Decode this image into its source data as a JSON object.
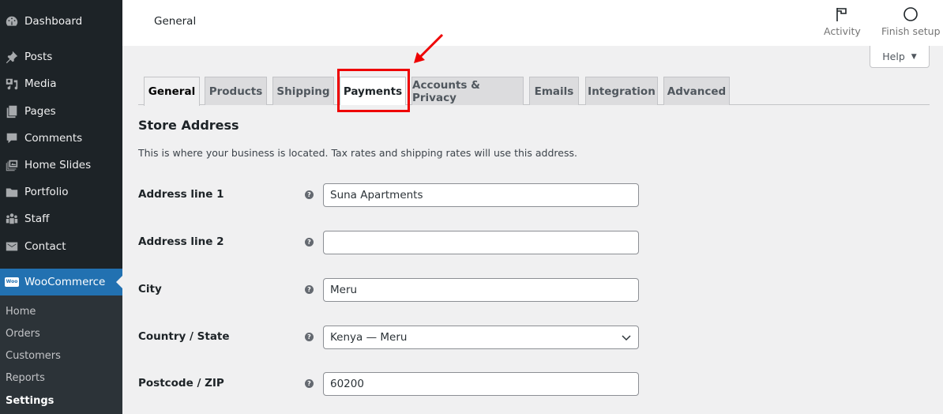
{
  "sidebar": {
    "items": [
      {
        "label": "Dashboard",
        "icon": "dashboard-icon"
      },
      {
        "label": "Posts",
        "icon": "pin-icon"
      },
      {
        "label": "Media",
        "icon": "media-icon"
      },
      {
        "label": "Pages",
        "icon": "pages-icon"
      },
      {
        "label": "Comments",
        "icon": "comment-icon"
      },
      {
        "label": "Home Slides",
        "icon": "slides-icon"
      },
      {
        "label": "Portfolio",
        "icon": "folder-icon"
      },
      {
        "label": "Staff",
        "icon": "group-icon"
      },
      {
        "label": "Contact",
        "icon": "mail-icon"
      },
      {
        "label": "WooCommerce",
        "icon": "woo-icon",
        "active": true
      }
    ],
    "submenu": [
      {
        "label": "Home"
      },
      {
        "label": "Orders"
      },
      {
        "label": "Customers"
      },
      {
        "label": "Reports"
      },
      {
        "label": "Settings",
        "current": true
      }
    ],
    "woo_badge": "Woo"
  },
  "header": {
    "title": "General",
    "activity_label": "Activity",
    "finish_setup_label": "Finish setup",
    "help_label": "Help",
    "help_caret": "▼"
  },
  "tabs": [
    {
      "label": "General",
      "active": true
    },
    {
      "label": "Products"
    },
    {
      "label": "Shipping"
    },
    {
      "label": "Payments",
      "highlighted": true
    },
    {
      "label": "Accounts & Privacy"
    },
    {
      "label": "Emails"
    },
    {
      "label": "Integration"
    },
    {
      "label": "Advanced"
    }
  ],
  "annotation": {
    "color": "#ee0000",
    "target": "Payments"
  },
  "section": {
    "title": "Store Address",
    "description": "This is where your business is located. Tax rates and shipping rates will use this address."
  },
  "fields": [
    {
      "label": "Address line 1",
      "value": "Suna Apartments",
      "help": "?"
    },
    {
      "label": "Address line 2",
      "value": "",
      "help": "?"
    },
    {
      "label": "City",
      "value": "Meru",
      "help": "?"
    },
    {
      "label": "Country / State",
      "value": "Kenya — Meru",
      "help": "?",
      "type": "select"
    },
    {
      "label": "Postcode / ZIP",
      "value": "60200",
      "help": "?"
    }
  ],
  "colors": {
    "sidebar_bg": "#1d2327",
    "submenu_bg": "#2c3338",
    "accent": "#2271b1",
    "page_bg": "#f0f0f1"
  }
}
